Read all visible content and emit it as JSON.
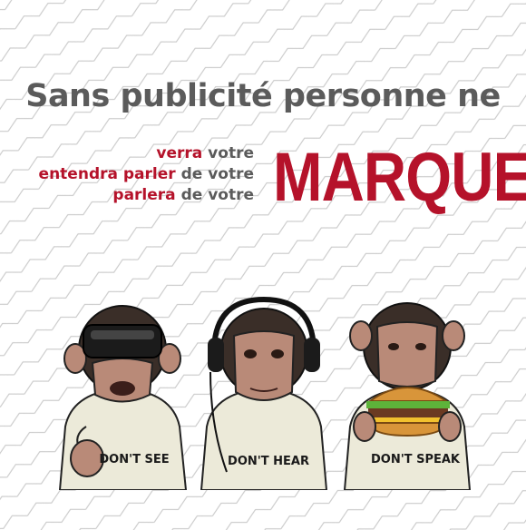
{
  "headline": "Sans publicité personne ne",
  "lines": [
    {
      "red": "verra",
      "rest": " votre"
    },
    {
      "red": "entendra parler",
      "rest": " de votre"
    },
    {
      "red": "parlera",
      "rest": " de votre"
    }
  ],
  "marque": "MARQUE",
  "monkeys": [
    {
      "shirt": "DON'T SEE"
    },
    {
      "shirt": "DON'T HEAR"
    },
    {
      "shirt": "DON'T SPEAK"
    }
  ],
  "colors": {
    "brand_red": "#b5122a",
    "gray_text": "#5b5b5b"
  }
}
